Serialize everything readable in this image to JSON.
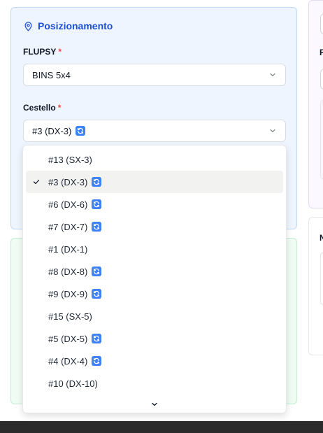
{
  "posizionamento": {
    "title": "Posizionamento",
    "flupsy_label": "FLUPSY",
    "flupsy_value": "BINS 5x4",
    "cestello_label": "Cestello",
    "cestello_value": "#3 (DX-3)",
    "required_mark": "*"
  },
  "dropdown": {
    "options": [
      {
        "label": "#13 (SX-3)",
        "sync": false,
        "selected": false
      },
      {
        "label": "#3 (DX-3)",
        "sync": true,
        "selected": true
      },
      {
        "label": "#6 (DX-6)",
        "sync": true,
        "selected": false
      },
      {
        "label": "#7 (DX-7)",
        "sync": true,
        "selected": false
      },
      {
        "label": "#1 (DX-1)",
        "sync": false,
        "selected": false
      },
      {
        "label": "#8 (DX-8)",
        "sync": true,
        "selected": false
      },
      {
        "label": "#9 (DX-9)",
        "sync": true,
        "selected": false
      },
      {
        "label": "#15 (SX-5)",
        "sync": false,
        "selected": false
      },
      {
        "label": "#5 (DX-5)",
        "sync": true,
        "selected": false
      },
      {
        "label": "#4 (DX-4)",
        "sync": true,
        "selected": false
      },
      {
        "label": "#10 (DX-10)",
        "sync": false,
        "selected": false
      }
    ]
  },
  "right_panel": {
    "letter_1": "F",
    "letter_2": "N"
  },
  "colors": {
    "accent_blue": "#1d4ed8",
    "sync_icon_blue": "#3b82f6",
    "required_red": "#ef4444"
  }
}
